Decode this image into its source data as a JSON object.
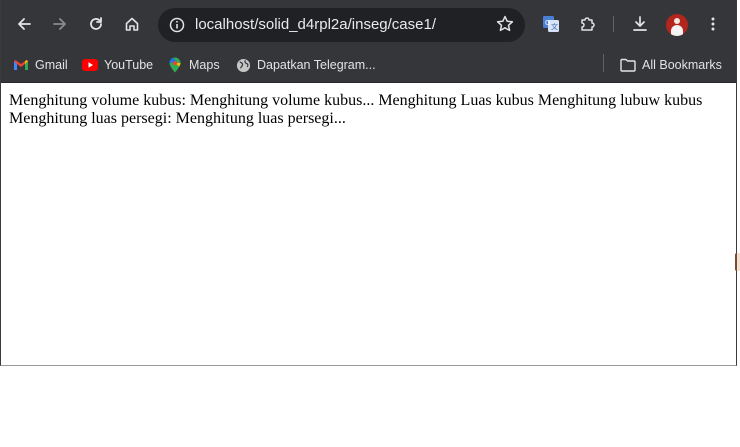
{
  "browser": {
    "address_bar": {
      "url": "localhost/solid_d4rpl2a/inseg/case1/"
    },
    "toolbar_icons": [
      "back-icon",
      "forward-icon",
      "reload-icon",
      "home-icon",
      "site-info-icon",
      "star-icon",
      "translate-icon",
      "extensions-icon",
      "download-icon",
      "profile-avatar",
      "menu-icon"
    ],
    "bookmarks": [
      {
        "label": "Gmail",
        "icon": "gmail-icon"
      },
      {
        "label": "YouTube",
        "icon": "youtube-icon"
      },
      {
        "label": "Maps",
        "icon": "maps-icon"
      },
      {
        "label": "Dapatkan Telegram...",
        "icon": "globe-icon"
      }
    ],
    "all_bookmarks_label": "All Bookmarks"
  },
  "page": {
    "line1": "Menghitung volume kubus: Menghitung volume kubus... Menghitung Luas kubus Menghitung lubuw kubus",
    "line2": "Menghitung luas persegi: Menghitung luas persegi..."
  },
  "colors": {
    "toolbar_bg": "#35363a",
    "omnibox_bg": "#202124",
    "text_light": "#e8eaed",
    "page_bg": "#ffffff"
  }
}
